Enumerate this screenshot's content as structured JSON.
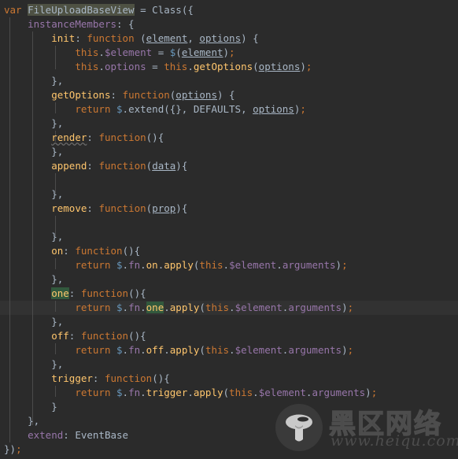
{
  "editor": {
    "theme_background": "#2b2b2b",
    "default_text_color": "#a9b7c6",
    "current_line_color": "#323232",
    "selection_color": "#4e5143",
    "usage_highlight_color": "#32593d",
    "font_size_px": 12.5,
    "line_height_px": 18,
    "language": "JavaScript",
    "current_line_number": 22
  },
  "colors": {
    "keyword": "#cc7832",
    "violet": "#9876aa",
    "yellow": "#ffc66d",
    "blue": "#6897bb",
    "default": "#a9b7c6",
    "guide": "#4b4b4b",
    "watermark": "#4d4d4d"
  },
  "code": {
    "lines": [
      "var FileUploadBaseView = Class({",
      "    instanceMembers: {",
      "        init: function (element, options) {",
      "            this.$element = $(element);",
      "            this.options = this.getOptions(options);",
      "        },",
      "        getOptions: function(options) {",
      "            return $.extend({}, DEFAULTS, options);",
      "        },",
      "        render: function(){",
      "        },",
      "        append: function(data){",
      "",
      "        },",
      "        remove: function(prop){",
      "",
      "        },",
      "        on: function(){",
      "            return $.fn.on.apply(this.$element.arguments);",
      "        },",
      "        one: function(){",
      "            return $.fn.one.apply(this.$element.arguments);",
      "        },",
      "        off: function(){",
      "            return $.fn.off.apply(this.$element.arguments);",
      "        },",
      "        trigger: function(){",
      "            return $.fn.trigger.apply(this.$element.arguments);",
      "        }",
      "    },",
      "    extend: EventBase",
      "});"
    ],
    "selected_token": "FileUploadBaseView",
    "highlighted_usages": "one",
    "misspelled_token": "render"
  },
  "watermark": {
    "brand_cn": "黑区网络",
    "url": "www.heiqu.com",
    "logo_icon": "mushroom-icon"
  }
}
